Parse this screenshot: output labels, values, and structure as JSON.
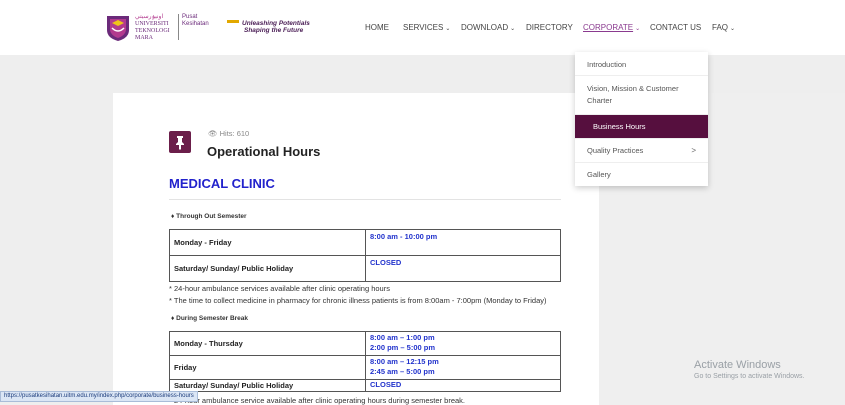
{
  "header": {
    "university_lines": [
      "UNIVERSITI",
      "TEKNOLOGI",
      "MARA"
    ],
    "university_arabic": "اونيۏرسيتي",
    "pusat_lines": [
      "Pusat",
      "Kesihatan"
    ],
    "tagline_lines": [
      "Unleashing Potentials",
      "Shaping the Future"
    ]
  },
  "nav": {
    "items": [
      {
        "label": "HOME"
      },
      {
        "label": "SERVICES",
        "chevron": "chevron-down-icon"
      },
      {
        "label": "DOWNLOAD",
        "chevron": "chevron-down-icon"
      },
      {
        "label": "DIRECTORY"
      },
      {
        "label": "CORPORATE",
        "chevron": "chevron-down-icon",
        "active": true
      },
      {
        "label": "CONTACT US"
      },
      {
        "label": "FAQ",
        "chevron": "chevron-down-icon"
      }
    ],
    "chevron_glyph": "⌄"
  },
  "dropdown": {
    "items": [
      {
        "label": "Introduction"
      },
      {
        "label": "Vision, Mission & Customer Charter"
      },
      {
        "label": "Business Hours",
        "active": true
      },
      {
        "label": "Quality Practices",
        "arrow": ">"
      },
      {
        "label": "Gallery"
      }
    ]
  },
  "article": {
    "icon": "pin-icon",
    "hits": "Hits: 610",
    "title": "Operational Hours",
    "section_heading": "MEDICAL CLINIC",
    "semester_label": "Through Out Semester",
    "semester_rows": [
      {
        "day": "Monday - Friday",
        "times": [
          "8:00 am - 10:00 pm"
        ]
      },
      {
        "day": "Saturday/ Sunday/ Public Holiday",
        "times": [
          "CLOSED"
        ]
      }
    ],
    "semester_notes": [
      "* 24-hour ambulance services available after clinic operating hours",
      "* The time to collect medicine in pharmacy for chronic illness patients is from 8:00am - 7:00pm (Monday to Friday)"
    ],
    "break_label": "During Semester Break",
    "break_rows": [
      {
        "day": "Monday - Thursday",
        "times": [
          "8:00 am – 1:00 pm",
          "2:00 pm – 5:00 pm"
        ]
      },
      {
        "day": "Friday",
        "times": [
          "8:00 am – 12:15 pm",
          "2:45 am – 5:00 pm"
        ]
      },
      {
        "day": "Saturday/ Sunday/ Public Holiday",
        "times": [
          "CLOSED"
        ]
      }
    ],
    "break_note_partial": "* 24-hour ambulance service available after clinic operating hours during semester break."
  },
  "watermark": {
    "line1": "Activate Windows",
    "line2": "Go to Settings to activate Windows."
  },
  "status_bar": {
    "url": "https://pusatkesihatan.uitm.edu.my/index.php/corporate/business-hours"
  },
  "colors": {
    "brand_purple": "#560f3e",
    "nav_active": "#8a3a8f",
    "clinic_blue": "#2222cc",
    "time_blue": "#2233cc"
  }
}
